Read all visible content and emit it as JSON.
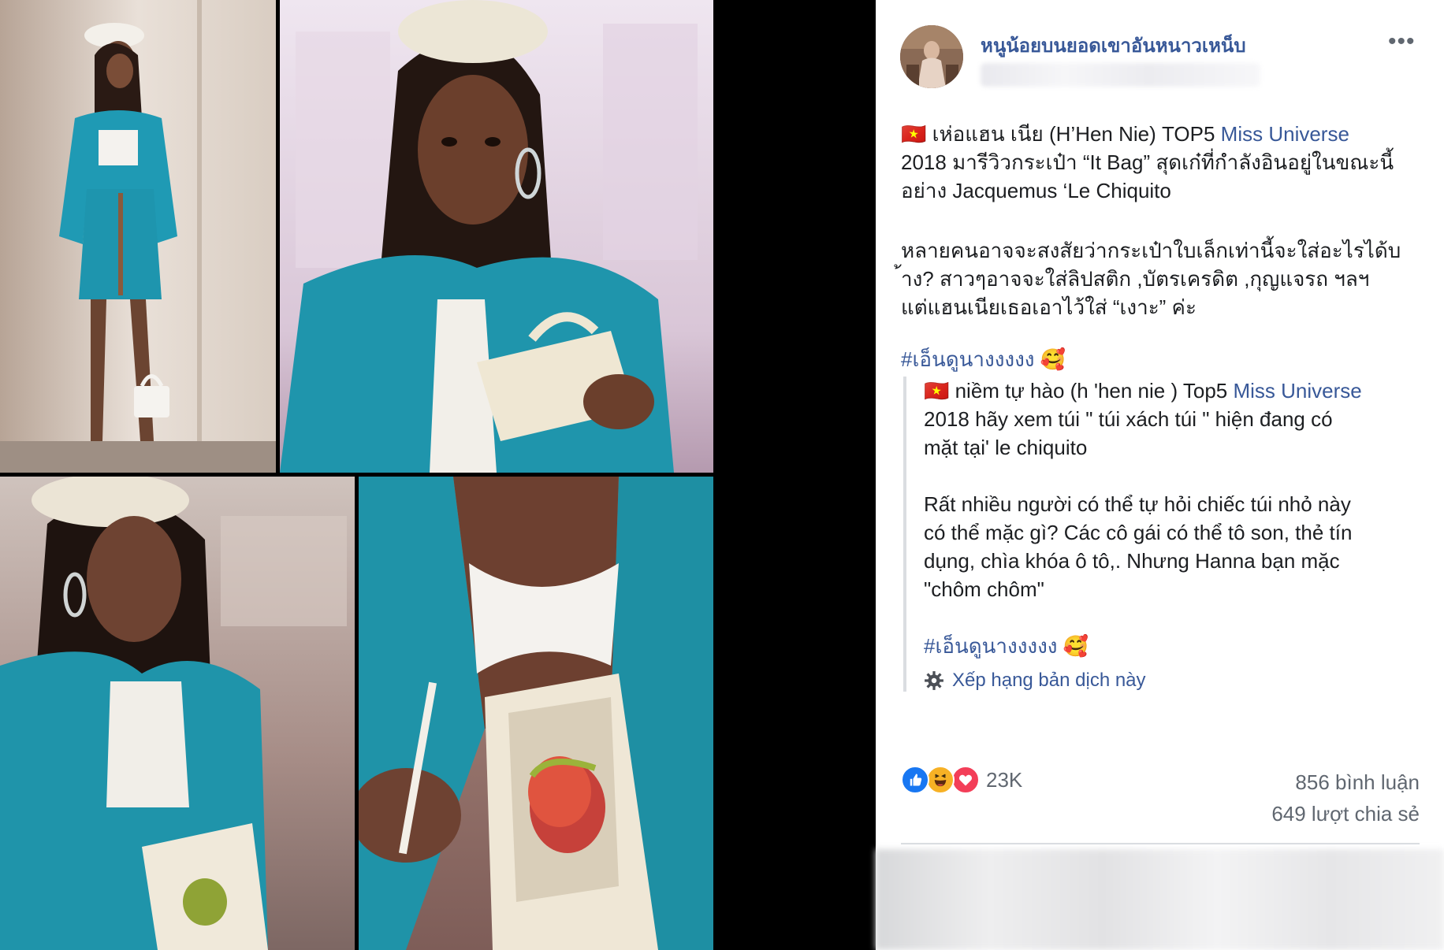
{
  "post": {
    "author": "หนูน้อยบนยอดเขาอันหนาวเหน็บ",
    "more_label": "•••",
    "para1_flag": "🇻🇳",
    "para1_a": " เห่อแฮน เนีย (H’Hen Nie) TOP5 ",
    "para1_link": "Miss Universe",
    "para1_b": "\n2018 มารีวิวกระเป๋า “It Bag” สุดเก๋ที่กำลังอินอยู่ในขณะนี้\nอย่าง Jacquemus ‘Le Chiquito",
    "para2": "หลายคนอาจจะสงสัยว่ากระเป๋าใบเล็กเท่านี้จะใส่อะไรได้บ\n้าง? สาวๆอาจจะใส่ลิปสติก ,บัตรเครดิต ,กุญแจรถ ฯลฯ\nแต่แฮนเนียเธอเอาไว้ใส่ “เงาะ” ค่ะ",
    "hashtag": "#เอ็นดูนางงงงง",
    "hashtag_emoji": "🥰"
  },
  "translation": {
    "flag": "🇻🇳",
    "p1_a": " niềm tự hào (h 'hen nie ) Top5 ",
    "p1_link": "Miss Universe",
    "p1_b": "\n2018 hãy xem túi \" túi xách túi \" hiện đang có\nmặt tại' le chiquito",
    "p2": "Rất nhiều người có thể tự hỏi chiếc túi nhỏ này\ncó thể mặc gì? Các cô gái có thể tô son, thẻ tín\ndụng, chìa khóa ô tô,. Nhưng Hanna bạn mặc\n\"chôm chôm\"",
    "hashtag": "#เอ็นดูนางงงงง",
    "hashtag_emoji": "🥰",
    "rate_label": "Xếp hạng bản dịch này"
  },
  "stats": {
    "reactions_count": "23K",
    "comments": "856 bình luận",
    "shares": "649 lượt chia sẻ"
  },
  "icons": {
    "like": "like-icon",
    "haha": "haha-icon",
    "love": "love-icon",
    "gear": "gear-icon"
  },
  "colors": {
    "link": "#385898",
    "like": "#1877f2",
    "love": "#f33e58",
    "haha": "#f7b125",
    "jacket": "#1f9ab4"
  }
}
